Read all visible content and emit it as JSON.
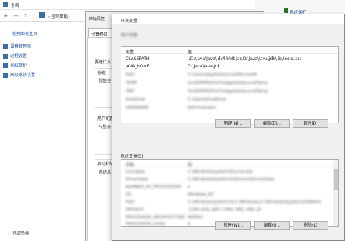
{
  "system_window": {
    "title": "系统",
    "nav_glyphs": "← → ↑",
    "breadcrumb": "› 控制面板 ›",
    "left_pane": {
      "home": "控制面板主页",
      "links": [
        {
          "label": "设备管理器",
          "icon_color": "#3a6ea5"
        },
        {
          "label": "远程设置",
          "icon_color": "#3a6ea5"
        },
        {
          "label": "系统保护",
          "icon_color": "#3a6ea5"
        },
        {
          "label": "高级系统设置",
          "icon_color": "#3a6ea5"
        }
      ],
      "see_also": "另请参阅"
    },
    "right_link": "系统保护"
  },
  "system_properties": {
    "title": "系统属性",
    "tab": "计算机名",
    "lines": [
      {
        "text": "要进行大"
      },
      {
        "text": "性能"
      },
      {
        "text": "视觉效"
      },
      {
        "text": "用户配置"
      },
      {
        "text": "与登录"
      },
      {
        "text": "启动和故"
      },
      {
        "text": "系统启"
      }
    ]
  },
  "env_vars": {
    "title": "环境变量",
    "user_vars_label": "用户变量",
    "header_var": "变量",
    "header_val": "值",
    "user_rows": [
      {
        "var": "CLASSPATH",
        "val": ".;D:\\java\\Java\\jdk\\lib\\dt.jar;D:\\java\\Java\\jdk\\lib\\tools.jar;",
        "blur": false
      },
      {
        "var": "JAVA_HOME",
        "val": "D:\\java\\Java\\jdk",
        "blur": false
      },
      {
        "var": "Path",
        "val": "C:\\Users\\AppData\\Local\\Microsoft",
        "blur": true
      },
      {
        "var": "TEMP",
        "val": "%USERPROFILE%\\AppData\\Local\\Temp",
        "blur": true
      },
      {
        "var": "TMP",
        "val": "%USERPROFILE%\\AppData\\Local\\Temp",
        "blur": true
      },
      {
        "var": "OneDrive",
        "val": "C:\\Users\\OneDrive",
        "blur": true
      },
      {
        "var": "USERNAME",
        "val": "Administrator",
        "blur": true
      }
    ],
    "user_buttons": {
      "new": "新建(N)...",
      "edit": "编辑(E)...",
      "delete": "删除(D)"
    },
    "sys_vars_label": "系统变量(S)",
    "sys_rows": [
      {
        "var": "ComSpec",
        "val": "C:\\Windows\\system32\\cmd.exe"
      },
      {
        "var": "DriverData",
        "val": "C:\\Windows\\System32\\Drivers\\DriverData"
      },
      {
        "var": "NUMBER_OF_PROCESSORS",
        "val": "4"
      },
      {
        "var": "OS",
        "val": "Windows_NT"
      },
      {
        "var": "Path",
        "val": "C:\\Windows\\system32;C:\\Windows;C:\\Windows\\System32\\Wbem"
      },
      {
        "var": "PATHEXT",
        "val": ".COM;.EXE;.BAT;.CMD;.VBS;.VBE;.JS"
      },
      {
        "var": "PROCESSOR_ARCHITECTURE",
        "val": "AMD64"
      },
      {
        "var": "PROCESSOR_LEVEL",
        "val": "6"
      }
    ],
    "sys_buttons": {
      "new": "新建(W)...",
      "edit": "编辑(I)...",
      "delete": "删除(L)"
    }
  }
}
